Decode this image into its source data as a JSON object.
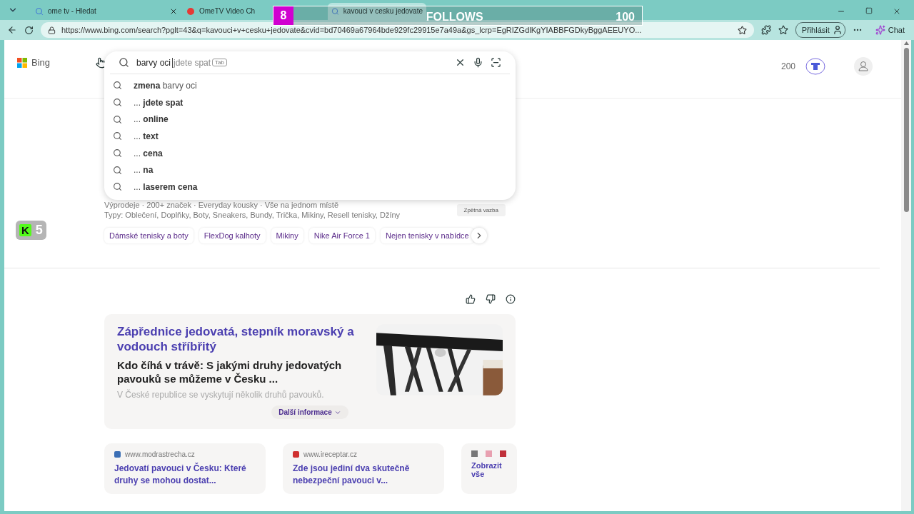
{
  "browser": {
    "tabs": [
      {
        "title": "ome tv - Hledat",
        "selected": false
      },
      {
        "title": "OmeTV Video Ch",
        "selected": false
      },
      {
        "title": "kavouci v cesku jedovate",
        "selected": true
      }
    ],
    "url": "https://www.bing.com/search?pglt=43&q=kavouci+v+cesku+jedovate&cvid=bd70469a67964bde929fc29915e7a49a&gs_lcrp=EgRIZGdlKgYIABBFGDkyBggAEEUYO...",
    "signin": "Přihlásit",
    "chat": "Chat"
  },
  "stream_overlay": {
    "count": "8",
    "label": "FOLLOWS",
    "goal": "100"
  },
  "stream_badge": {
    "letter": "K",
    "count": "5"
  },
  "header": {
    "logo": "Bing",
    "points": "200"
  },
  "search": {
    "value": "barvy oci",
    "completion": "jdete spat",
    "key_hint": "Tab",
    "suggestions": [
      "**zmena** barvy oci",
      "... **jdete spat**",
      "... **online**",
      "... **text**",
      "... **cena**",
      "... **na**",
      "... **laserem cena**"
    ]
  },
  "ad": {
    "description": "Výprodeje · 200+ značek · Everyday kousky · Vše na jednom místě",
    "types": "Typy: Oblečení, Doplňky, Boty, Sneakers, Bundy, Trička, Mikiny, Resell tenisky, Džíny",
    "feedback": "Zpětná vazba",
    "chips": [
      "Dámské tenisky a boty",
      "FlexDog kalhoty",
      "Mikiny",
      "Nike Air Force 1",
      "Nejen tenisky v nabídce"
    ]
  },
  "answer": {
    "title": "Zápřednice jedovatá, stepník moravský a vodouch stříbřitý",
    "headline": "Kdo číhá v trávě: S jakými druhy jedovatých pavouků se můžeme v Česku ...",
    "snippet": "V České republice se vyskytují několik druhů pavouků.",
    "more": "Další informace",
    "sources": [
      {
        "domain": "www.modrastrecha.cz",
        "title": "Jedovatí pavouci v Česku: Které druhy se mohou dostat...",
        "color": "#3b6fb5"
      },
      {
        "domain": "www.ireceptar.cz",
        "title": "Zde jsou jediní dva skutečně nebezpeční pavouci v...",
        "color": "#d0302f"
      }
    ],
    "show_all": "Zobrazit vše"
  }
}
